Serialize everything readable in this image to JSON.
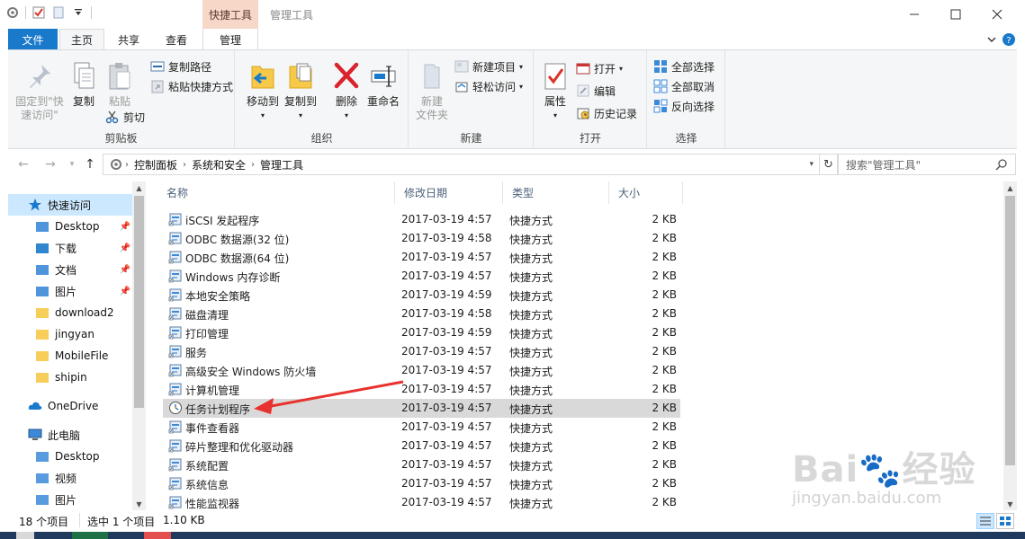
{
  "titlebar": {
    "context_tab": "快捷工具",
    "title": "管理工具"
  },
  "tabs": {
    "file": "文件",
    "home": "主页",
    "share": "共享",
    "view": "查看",
    "manage": "管理"
  },
  "ribbon": {
    "clipboard": {
      "label": "剪贴板",
      "pin_quick_access_line1": "固定到\"快",
      "pin_quick_access_line2": "速访问\"",
      "copy": "复制",
      "paste": "粘贴",
      "copy_path": "复制路径",
      "paste_shortcut": "粘贴快捷方式",
      "cut": "剪切"
    },
    "organize": {
      "label": "组织",
      "move_to": "移动到",
      "copy_to": "复制到",
      "delete": "删除",
      "rename": "重命名"
    },
    "new": {
      "label": "新建",
      "new_folder_line1": "新建",
      "new_folder_line2": "文件夹",
      "new_item": "新建项目",
      "easy_access": "轻松访问"
    },
    "open": {
      "label": "打开",
      "properties": "属性",
      "open": "打开",
      "edit": "编辑",
      "history": "历史记录"
    },
    "select": {
      "label": "选择",
      "select_all": "全部选择",
      "select_none": "全部取消",
      "invert": "反向选择"
    }
  },
  "address": {
    "crumbs": [
      "控制面板",
      "系统和安全",
      "管理工具"
    ],
    "search_placeholder": "搜索\"管理工具\""
  },
  "navpane": {
    "quick_access": "快速访问",
    "items": [
      {
        "label": "Desktop",
        "icon": "desktop-icon"
      },
      {
        "label": "下载",
        "icon": "download-icon"
      },
      {
        "label": "文档",
        "icon": "document-icon"
      },
      {
        "label": "图片",
        "icon": "pictures-icon"
      },
      {
        "label": "download2",
        "icon": "folder-icon"
      },
      {
        "label": "jingyan",
        "icon": "folder-icon"
      },
      {
        "label": "MobileFile",
        "icon": "folder-icon"
      },
      {
        "label": "shipin",
        "icon": "folder-icon"
      }
    ],
    "onedrive": "OneDrive",
    "this_pc": "此电脑",
    "pc_items": [
      {
        "label": "Desktop",
        "icon": "desktop-icon"
      },
      {
        "label": "视频",
        "icon": "video-icon"
      },
      {
        "label": "图片",
        "icon": "pictures-icon"
      }
    ]
  },
  "columns": {
    "name": "名称",
    "modified": "修改日期",
    "type": "类型",
    "size": "大小"
  },
  "files": [
    {
      "name": "iSCSI 发起程序",
      "date": "2017-03-19 4:57",
      "type": "快捷方式",
      "size": "2 KB"
    },
    {
      "name": "ODBC 数据源(32 位)",
      "date": "2017-03-19 4:58",
      "type": "快捷方式",
      "size": "2 KB"
    },
    {
      "name": "ODBC 数据源(64 位)",
      "date": "2017-03-19 4:57",
      "type": "快捷方式",
      "size": "2 KB"
    },
    {
      "name": "Windows 内存诊断",
      "date": "2017-03-19 4:57",
      "type": "快捷方式",
      "size": "2 KB"
    },
    {
      "name": "本地安全策略",
      "date": "2017-03-19 4:59",
      "type": "快捷方式",
      "size": "2 KB"
    },
    {
      "name": "磁盘清理",
      "date": "2017-03-19 4:58",
      "type": "快捷方式",
      "size": "2 KB"
    },
    {
      "name": "打印管理",
      "date": "2017-03-19 4:59",
      "type": "快捷方式",
      "size": "2 KB"
    },
    {
      "name": "服务",
      "date": "2017-03-19 4:57",
      "type": "快捷方式",
      "size": "2 KB"
    },
    {
      "name": "高级安全 Windows 防火墙",
      "date": "2017-03-19 4:57",
      "type": "快捷方式",
      "size": "2 KB"
    },
    {
      "name": "计算机管理",
      "date": "2017-03-19 4:57",
      "type": "快捷方式",
      "size": "2 KB"
    },
    {
      "name": "任务计划程序",
      "date": "2017-03-19 4:57",
      "type": "快捷方式",
      "size": "2 KB"
    },
    {
      "name": "事件查看器",
      "date": "2017-03-19 4:57",
      "type": "快捷方式",
      "size": "2 KB"
    },
    {
      "name": "碎片整理和优化驱动器",
      "date": "2017-03-19 4:57",
      "type": "快捷方式",
      "size": "2 KB"
    },
    {
      "name": "系统配置",
      "date": "2017-03-19 4:57",
      "type": "快捷方式",
      "size": "2 KB"
    },
    {
      "name": "系统信息",
      "date": "2017-03-19 4:57",
      "type": "快捷方式",
      "size": "2 KB"
    },
    {
      "name": "性能监视器",
      "date": "2017-03-19 4:57",
      "type": "快捷方式",
      "size": "2 KB"
    }
  ],
  "selected_index": 10,
  "status": {
    "count": "18 个项目",
    "selection": "选中 1 个项目",
    "size": "1.10 KB"
  },
  "watermark": {
    "brand": "Bai",
    "brand2": "经验",
    "url": "jingyan.baidu.com"
  },
  "colors": {
    "accent": "#1979ca",
    "selection": "#cce8ff",
    "context_tab": "#f7d7c8",
    "annotation_arrow": "#e8322f"
  }
}
